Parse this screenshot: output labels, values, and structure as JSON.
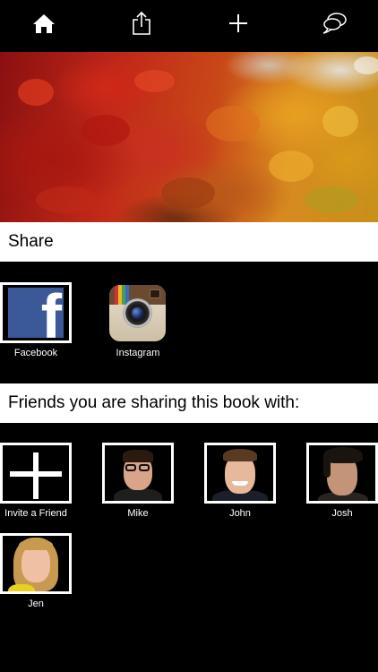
{
  "toolbar": {
    "items": [
      {
        "icon": "home-icon"
      },
      {
        "icon": "share-icon"
      },
      {
        "icon": "plus-icon"
      },
      {
        "icon": "speech-bubbles-icon"
      }
    ]
  },
  "hero": {
    "description_icon": "autumn-leaves-cover-image"
  },
  "share": {
    "heading": "Share",
    "services": [
      {
        "label": "Facebook",
        "icon": "facebook-icon",
        "color": "#3b5998"
      },
      {
        "label": "Instagram",
        "icon": "instagram-icon"
      }
    ]
  },
  "friends": {
    "heading": "Friends you are sharing this book with:",
    "invite_label": "Invite a Friend",
    "people": [
      {
        "name": "Mike"
      },
      {
        "name": "John"
      },
      {
        "name": "Josh"
      },
      {
        "name": "Jen"
      }
    ]
  }
}
